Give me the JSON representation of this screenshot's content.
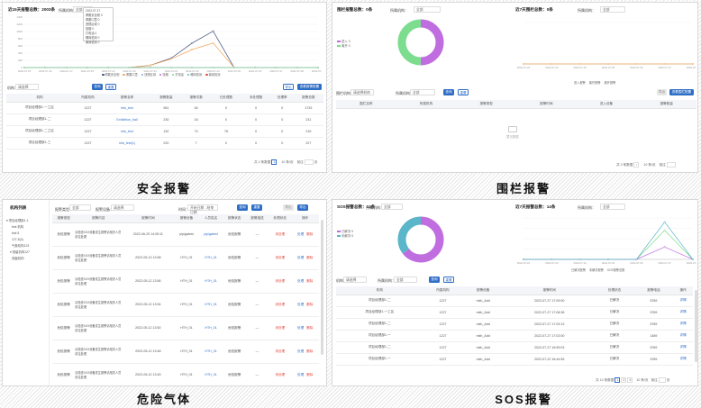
{
  "captions": {
    "safety": "安全报警",
    "fence": "围栏报警",
    "gas": "危险气体",
    "sos": "SOS报警"
  },
  "colors": {
    "blue": "#2f6ec6",
    "purple": "#c06de0",
    "green": "#7cdd8e",
    "teal": "#5ab6c8",
    "orange": "#f2a65a",
    "navy": "#3b4a7a"
  },
  "safety": {
    "title": "近15天报警总数：2003条",
    "org_label": "所属机构：",
    "org_value": "全部",
    "tooltip": {
      "date": "2022-07-17",
      "items": [
        "佩戴安全帽 0",
        "佩戴口罩 0",
        "违规区域 0",
        "吸烟 0",
        "打电话 0",
        "睡岗检测 0",
        "离岗检测 0"
      ]
    },
    "chart_data": {
      "type": "line",
      "x": [
        "2022-07-15",
        "2022-07-16",
        "2022-07-17",
        "2022-07-18",
        "2022-07-19",
        "2022-07-20",
        "2022-07-21",
        "2022-07-22",
        "2022-07-23",
        "2022-07-24",
        "2022-07-25",
        "2022-07-26",
        "2022-07-27",
        "2022-07-28",
        "2022-07-29"
      ],
      "ylim": [
        0,
        1400
      ],
      "yticks": [
        "1400",
        "1200",
        "1000",
        "800",
        "600",
        "400",
        "200",
        "0"
      ],
      "series": [
        {
          "name": "佩戴安全帽",
          "color": "#3b4a7a",
          "values": [
            0,
            0,
            0,
            0,
            0,
            0,
            60,
            260,
            680,
            1010,
            0,
            0,
            0,
            0,
            0
          ]
        },
        {
          "name": "佩戴口罩",
          "color": "#f2a65a",
          "values": [
            0,
            0,
            0,
            0,
            0,
            0,
            60,
            240,
            500,
            680,
            0,
            0,
            0,
            0,
            0
          ]
        },
        {
          "name": "违规区域",
          "color": "#8ab0e6",
          "values": [
            0,
            0,
            0,
            0,
            0,
            0,
            0,
            0,
            0,
            0,
            0,
            0,
            0,
            0,
            0
          ]
        },
        {
          "name": "吸烟",
          "color": "#c06de0",
          "values": [
            0,
            0,
            0,
            0,
            0,
            0,
            0,
            0,
            0,
            0,
            0,
            0,
            0,
            0,
            0
          ]
        },
        {
          "name": "打电话",
          "color": "#7cdd8e",
          "values": [
            0,
            0,
            0,
            0,
            0,
            0,
            0,
            0,
            0,
            0,
            0,
            0,
            0,
            0,
            0
          ]
        }
      ]
    },
    "legend": [
      "佩戴安全帽",
      "佩戴口罩",
      "违规区域",
      "吸烟",
      "打电话",
      "睡岗检测",
      "离岗检测"
    ],
    "filter": {
      "label": "机构：",
      "placeholder": "请选择",
      "query": "查询",
      "reset": "重置",
      "export": "导出",
      "config": "查看报警配置"
    },
    "columns": [
      "机构",
      "所属机构",
      "报警名称",
      "报警数量",
      "报警次数",
      "已处理数",
      "未处理数",
      "处理率",
      "报警总数"
    ],
    "rows": [
      [
        "项目经理部1-一工区",
        "1227",
        "Infu_test",
        "961",
        "54",
        "0",
        "0",
        "0",
        "1733"
      ],
      [
        "项目经理部1-二",
        "1227",
        "Exhibition_hall",
        "230",
        "16",
        "0",
        "0",
        "0",
        "231"
      ],
      [
        "项目经理部1-二工区",
        "1227",
        "Infu_test",
        "132",
        "74",
        "78",
        "0",
        "0",
        "215"
      ],
      [
        "项目经理部1-三",
        "1227",
        "Infu_test(1)",
        "220",
        "7",
        "0",
        "0",
        "0",
        "227"
      ]
    ],
    "pager": {
      "total": "共 4 条数据",
      "page": "1",
      "size": "10 条/页",
      "goto": "前往",
      "unit": "页"
    }
  },
  "fence": {
    "title": "围栏报警总数：0条",
    "org_label": "所属机构：",
    "org_value": "全部",
    "legend": [
      "进入 0",
      "离开 0"
    ],
    "title2": "近7天围栏总数：0条",
    "org2_label": "所属机构：",
    "org2_value": "全部",
    "x": [
      "2022-07-22",
      "2022-07-23",
      "2022-07-24",
      "2022-07-25",
      "2022-07-26",
      "2022-07-27",
      "2022-07-28"
    ],
    "legend2": [
      "进入报警",
      "离开报警",
      "离开报警"
    ],
    "filter": {
      "label": "围栏机构：",
      "placeholder": "请选择机构",
      "label2": "所属机构：",
      "value2": "全部",
      "query": "查询",
      "reset": "重置",
      "export": "导出",
      "config": "查看围栏配置"
    },
    "columns": [
      "围栏名称",
      "所属机构",
      "报警类型",
      "报警时间",
      "进入设备",
      "报警数量"
    ],
    "empty": "暂无数据",
    "pager": {
      "total": "共 0 条数据",
      "size": "10 条/页",
      "goto": "前往"
    }
  },
  "gas": {
    "tree_title": "机构列表",
    "tree": [
      "项目经理部1-1",
      "test 机构",
      "test 5",
      "127-5(3)",
      "气象机构123",
      "测量机构127",
      "测量机构"
    ],
    "filter": {
      "label": "报警类型：",
      "value": "全部",
      "label2": "报警设备：",
      "placeholder": "请选择",
      "label3": "时间：",
      "date_placeholder": "开始日期 - 结束日期",
      "query": "查询",
      "reset": "重置",
      "export": "导出",
      "export2": "导出"
    },
    "columns": [
      "报警类型",
      "报警内容",
      "报警时间",
      "报警设备",
      "人员姓名",
      "报警状态",
      "报警描述",
      "处理状态",
      "操作"
    ],
    "rows": [
      [
        "危险报警",
        "请检查XXX设备发生报警请相关人员前往处理",
        "2022-06-29 14:05:11",
        "pipigatest",
        "pipigatest",
        "危险报警",
        "—",
        "未处理",
        "处理",
        "删除"
      ],
      [
        "危险报警",
        "请检查XXX设备发生报警请相关人员前往处理",
        "2022-05-13 13:58",
        "HTH_01",
        "HTH_01",
        "危险报警",
        "—",
        "未处理",
        "处理",
        "删除"
      ],
      [
        "危险报警",
        "请检查XXX设备发生报警请相关人员前往处理",
        "2022-05-12 13:56",
        "HTH_01",
        "HTH_01",
        "危险报警",
        "—",
        "未处理",
        "处理",
        "删除"
      ],
      [
        "危险报警",
        "请检查XXX设备发生报警请相关人员前往处理",
        "2022-05-12 13:54",
        "HTH_01",
        "HTH_01",
        "危险报警",
        "—",
        "未处理",
        "处理",
        "删除"
      ],
      [
        "危险报警",
        "请检查XXX设备发生报警请相关人员前往处理",
        "2022-05-12 13:50",
        "HTH_01",
        "HTH_01",
        "危险报警",
        "—",
        "未处理",
        "处理",
        "删除"
      ],
      [
        "危险报警",
        "请检查XXX设备发生报警请相关人员前往处理",
        "2022-05-12 13:48",
        "HTH_01",
        "HTH_01",
        "危险报警",
        "—",
        "未处理",
        "处理",
        "删除"
      ],
      [
        "危险报警",
        "请检查XXX设备发生报警请相关人员前往处理",
        "2022-05-12 13:45",
        "HTH_01",
        "HTH_01",
        "危险报警",
        "—",
        "未处理",
        "处理",
        "删除"
      ]
    ]
  },
  "sos": {
    "title": "SOS报警总数：14条",
    "org_label": "所属机构：",
    "org_value": "全部",
    "legend": [
      "已解决 9",
      "未解决 5"
    ],
    "donut": {
      "values": [
        9,
        5
      ],
      "colors": [
        "#c06de0",
        "#5ab6c8"
      ]
    },
    "title2": "近7天报警总数：14条",
    "org2_label": "所属机构：",
    "org2_value": "全部",
    "chart_data": {
      "type": "line",
      "x": [
        "2022-07-22",
        "2022-07-23",
        "2022-07-24",
        "2022-07-25",
        "2022-07-26",
        "2022-07-27",
        "2022-07-28"
      ],
      "ylim": [
        0,
        10
      ],
      "series": [
        {
          "name": "已解决报警",
          "color": "#7cdd8e",
          "values": [
            0,
            0,
            0,
            0,
            0,
            7,
            0
          ]
        },
        {
          "name": "未解决报警",
          "color": "#c06de0",
          "values": [
            0,
            0,
            0,
            0,
            0,
            3,
            0
          ]
        },
        {
          "name": "SOS报警总数",
          "color": "#5ab6c8",
          "values": [
            0,
            0,
            0,
            0,
            0,
            9,
            0
          ]
        }
      ]
    },
    "legend2": [
      "已解决报警",
      "未解决报警",
      "SOS报警总数"
    ],
    "filter": {
      "label": "机构：",
      "placeholder": "请选择",
      "label2": "所属机构：",
      "value2": "全部",
      "query": "查询",
      "reset": "重置"
    },
    "columns": [
      "机构",
      "所属机构",
      "报警设备",
      "报警时间",
      "处理状态",
      "报警电话",
      "操作"
    ],
    "rows": [
      [
        "项目经理部1-二",
        "1227",
        "mkh_Add",
        "2022-07-27 17:09:00",
        "已解决",
        "5789",
        "详情"
      ],
      [
        "项目经理部1-一工区",
        "1227",
        "mkh_Add",
        "2022-07-27 17:08:38",
        "已解决",
        "5789",
        "详情"
      ],
      [
        "项目经理部1-二",
        "1227",
        "mkh_Add",
        "2022-07-27 17:03:13",
        "已解决",
        "5789",
        "详情"
      ],
      [
        "项目经理部1-一",
        "1227",
        "mkh_Add",
        "2022-07-27 17:02:00",
        "已解决",
        "1489",
        "详情"
      ],
      [
        "项目经理部1-二",
        "1227",
        "mkh_Add",
        "2022-07-27 16:59:03",
        "已解决",
        "5789",
        "详情"
      ],
      [
        "项目经理部1-一",
        "1227",
        "mkh_Add",
        "2022-07-22 16:44:55",
        "已解决",
        "5789",
        "详情"
      ]
    ],
    "pager": {
      "total": "共 14 条数据",
      "pages": [
        "1",
        "2",
        "3"
      ],
      "size": "10 条/页",
      "goto": "前往",
      "unit": "页"
    }
  }
}
